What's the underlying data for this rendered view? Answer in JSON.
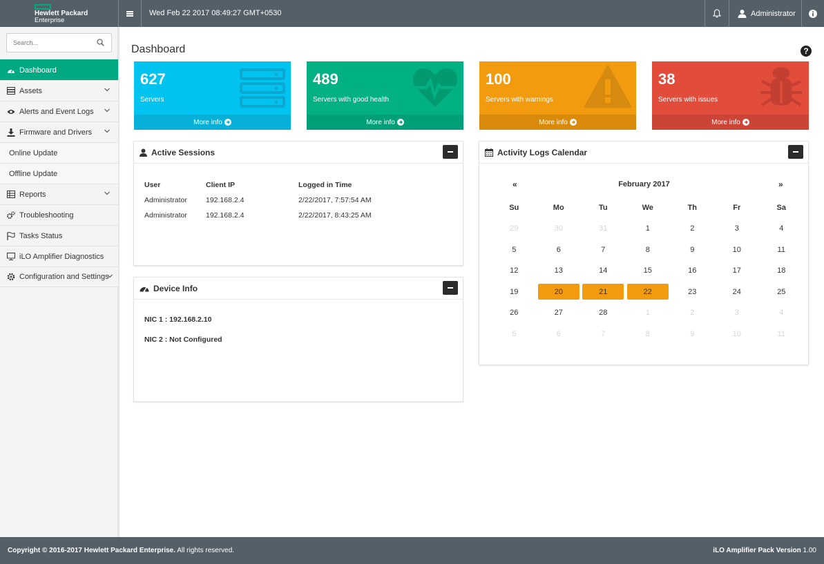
{
  "header": {
    "logo_line1": "Hewlett Packard",
    "logo_line2": "Enterprise",
    "datetime": "Wed Feb 22 2017 08:49:27 GMT+0530",
    "user": "Administrator",
    "icons": [
      "menu-icon",
      "bell-icon",
      "user-icon",
      "info-icon"
    ]
  },
  "sidebar": {
    "search_placeholder": "Search...",
    "items": [
      {
        "label": "Dashboard",
        "icon": "dashboard-icon",
        "active": true
      },
      {
        "label": "Assets",
        "icon": "server-icon",
        "expandable": true
      },
      {
        "label": "Alerts and Event Logs",
        "icon": "eye-icon",
        "expandable": true
      },
      {
        "label": "Firmware and Drivers",
        "icon": "download-icon",
        "expandable": true
      },
      {
        "label": "Online Update",
        "sub": true
      },
      {
        "label": "Offline Update",
        "sub": true
      },
      {
        "label": "Reports",
        "icon": "table-icon",
        "expandable": true
      },
      {
        "label": "Troubleshooting",
        "icon": "cogs-icon"
      },
      {
        "label": "Tasks Status",
        "icon": "flag-icon"
      },
      {
        "label": "iLO Amplifier Diagnostics",
        "icon": "monitor-icon"
      },
      {
        "label": "Configuration and Settings",
        "icon": "gear-icon",
        "expandable": true
      }
    ]
  },
  "main": {
    "title": "Dashboard",
    "tiles": [
      {
        "value": "627",
        "label": "Servers",
        "more": "More info",
        "color": "#00c3f0",
        "icon": "server-stack-icon"
      },
      {
        "value": "489",
        "label": "Servers with good health",
        "more": "More info",
        "color": "#01b083",
        "icon": "heartbeat-icon"
      },
      {
        "value": "100",
        "label": "Servers with warnings",
        "more": "More info",
        "color": "#f29b0f",
        "icon": "warning-icon"
      },
      {
        "value": "38",
        "label": "Servers with issues",
        "more": "More info",
        "color": "#e24c3b",
        "icon": "bug-icon"
      }
    ],
    "sessions": {
      "title": "Active Sessions",
      "headers": [
        "User",
        "Client IP",
        "Logged in Time"
      ],
      "rows": [
        [
          "Administrator",
          "192.168.2.4",
          "2/22/2017, 7:57:54 AM"
        ],
        [
          "Administrator",
          "192.168.2.4",
          "2/22/2017, 8:43:25 AM"
        ]
      ]
    },
    "device": {
      "title": "Device Info",
      "nic1": "NIC 1 : 192.168.2.10",
      "nic2": "NIC 2 : Not Configured"
    },
    "calendar": {
      "title": "Activity Logs Calendar",
      "month": "February 2017",
      "prev": "«",
      "next": "»",
      "weekdays": [
        "Su",
        "Mo",
        "Tu",
        "We",
        "Th",
        "Fr",
        "Sa"
      ],
      "days": [
        {
          "d": "29",
          "m": true
        },
        {
          "d": "30",
          "m": true
        },
        {
          "d": "31",
          "m": true
        },
        {
          "d": "1"
        },
        {
          "d": "2"
        },
        {
          "d": "3"
        },
        {
          "d": "4"
        },
        {
          "d": "5"
        },
        {
          "d": "6"
        },
        {
          "d": "7"
        },
        {
          "d": "8"
        },
        {
          "d": "9"
        },
        {
          "d": "10"
        },
        {
          "d": "11"
        },
        {
          "d": "12"
        },
        {
          "d": "13"
        },
        {
          "d": "14"
        },
        {
          "d": "15"
        },
        {
          "d": "16"
        },
        {
          "d": "17"
        },
        {
          "d": "18"
        },
        {
          "d": "19"
        },
        {
          "d": "20",
          "h": true
        },
        {
          "d": "21",
          "h": true
        },
        {
          "d": "22",
          "h": true
        },
        {
          "d": "23"
        },
        {
          "d": "24"
        },
        {
          "d": "25"
        },
        {
          "d": "26"
        },
        {
          "d": "27"
        },
        {
          "d": "28"
        },
        {
          "d": "1",
          "m": true
        },
        {
          "d": "2",
          "m": true
        },
        {
          "d": "3",
          "m": true
        },
        {
          "d": "4",
          "m": true
        },
        {
          "d": "5",
          "m": true
        },
        {
          "d": "6",
          "m": true
        },
        {
          "d": "7",
          "m": true
        },
        {
          "d": "8",
          "m": true
        },
        {
          "d": "9",
          "m": true
        },
        {
          "d": "10",
          "m": true
        },
        {
          "d": "11",
          "m": true
        }
      ]
    }
  },
  "footer": {
    "copyright_bold": "Copyright © 2016-2017 Hewlett Packard Enterprise.",
    "copyright_rest": " All rights reserved.",
    "version_bold": "iLO Amplifier Pack Version",
    "version_num": " 1.00"
  },
  "colors": {
    "header_bg": "#555f68",
    "accent": "#01a982"
  }
}
